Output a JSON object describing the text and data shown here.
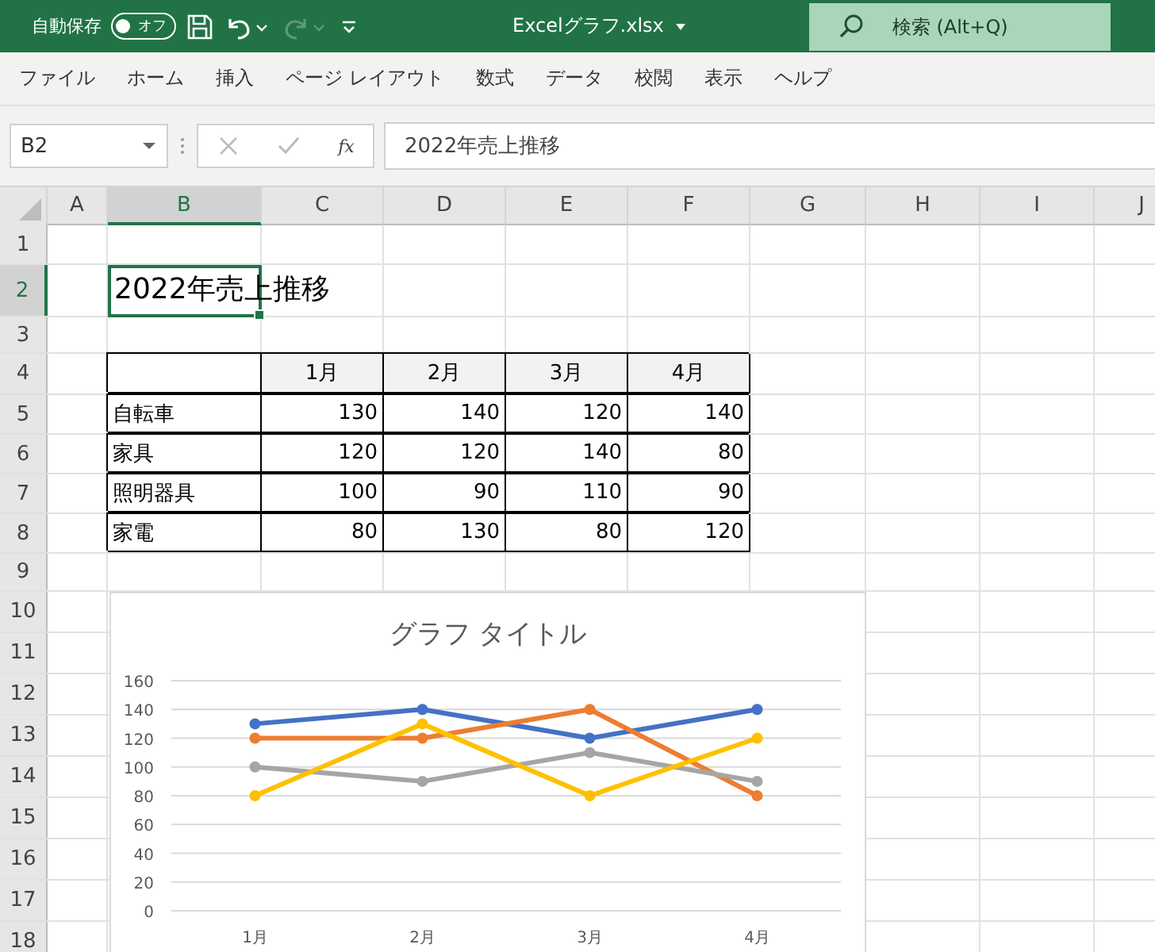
{
  "title_bar": {
    "autosave_label": "自動保存",
    "autosave_toggle": {
      "label": "オフ",
      "on": false
    },
    "redo_disabled": true,
    "file_name": "Excelグラフ.xlsx",
    "search_placeholder": "検索 (Alt+Q)"
  },
  "menu": [
    {
      "label": "ファイル",
      "selected": false
    },
    {
      "label": "ホーム",
      "selected": false
    },
    {
      "label": "挿入",
      "selected": false
    },
    {
      "label": "ページ レイアウト",
      "selected": false
    },
    {
      "label": "数式",
      "selected": false
    },
    {
      "label": "データ",
      "selected": false
    },
    {
      "label": "校閲",
      "selected": false
    },
    {
      "label": "表示",
      "selected": false
    },
    {
      "label": "ヘルプ",
      "selected": false
    }
  ],
  "formula_bar": {
    "name_box": "B2",
    "function_label": "fx",
    "value": "2022年売上推移"
  },
  "sheet": {
    "columns": [
      {
        "label": "A",
        "selected": false
      },
      {
        "label": "B",
        "selected": true
      },
      {
        "label": "C",
        "selected": false
      },
      {
        "label": "D",
        "selected": false
      },
      {
        "label": "E",
        "selected": false
      },
      {
        "label": "F",
        "selected": false
      },
      {
        "label": "G",
        "selected": false
      },
      {
        "label": "H",
        "selected": false
      },
      {
        "label": "I",
        "selected": false
      },
      {
        "label": "J",
        "selected": false
      }
    ],
    "rows": [
      {
        "number": "1",
        "selected": false
      },
      {
        "number": "2",
        "selected": true
      },
      {
        "number": "3",
        "selected": false
      },
      {
        "number": "4",
        "selected": false
      },
      {
        "number": "5",
        "selected": false
      },
      {
        "number": "6",
        "selected": false
      },
      {
        "number": "7",
        "selected": false
      },
      {
        "number": "8",
        "selected": false
      },
      {
        "number": "9",
        "selected": false
      },
      {
        "number": "10",
        "selected": false
      },
      {
        "number": "11",
        "selected": false
      },
      {
        "number": "12",
        "selected": false
      },
      {
        "number": "13",
        "selected": false
      },
      {
        "number": "14",
        "selected": false
      },
      {
        "number": "15",
        "selected": false
      },
      {
        "number": "16",
        "selected": false
      },
      {
        "number": "17",
        "selected": false
      },
      {
        "number": "18",
        "selected": false
      }
    ],
    "title_cell": {
      "text": "2022年売上推移",
      "selected": true
    },
    "table": {
      "header": [
        "1月",
        "2月",
        "3月",
        "4月"
      ],
      "rows": [
        {
          "label": "自転車",
          "values": [
            "130",
            "140",
            "120",
            "140"
          ]
        },
        {
          "label": "家具",
          "values": [
            "120",
            "120",
            "140",
            "80"
          ]
        },
        {
          "label": "照明器具",
          "values": [
            "100",
            "90",
            "110",
            "90"
          ]
        },
        {
          "label": "家電",
          "values": [
            "80",
            "130",
            "80",
            "120"
          ]
        }
      ]
    }
  },
  "chart": {
    "chart_data": {
      "type": "line",
      "title": "グラフ タイトル",
      "categories": [
        "1月",
        "2月",
        "3月",
        "4月"
      ],
      "ylim": [
        0,
        160
      ],
      "yticks": [
        0,
        20,
        40,
        60,
        80,
        100,
        120,
        140,
        160
      ],
      "grid": true,
      "series": [
        {
          "color": "#4472c4",
          "marker": "circle",
          "values": [
            130,
            140,
            120,
            140
          ]
        },
        {
          "color": "#ed7d31",
          "marker": "circle",
          "values": [
            120,
            120,
            140,
            80
          ]
        },
        {
          "color": "#a5a5a5",
          "marker": "circle",
          "values": [
            100,
            90,
            110,
            90
          ]
        },
        {
          "color": "#ffc000",
          "marker": "circle",
          "values": [
            80,
            130,
            80,
            120
          ]
        }
      ]
    }
  }
}
